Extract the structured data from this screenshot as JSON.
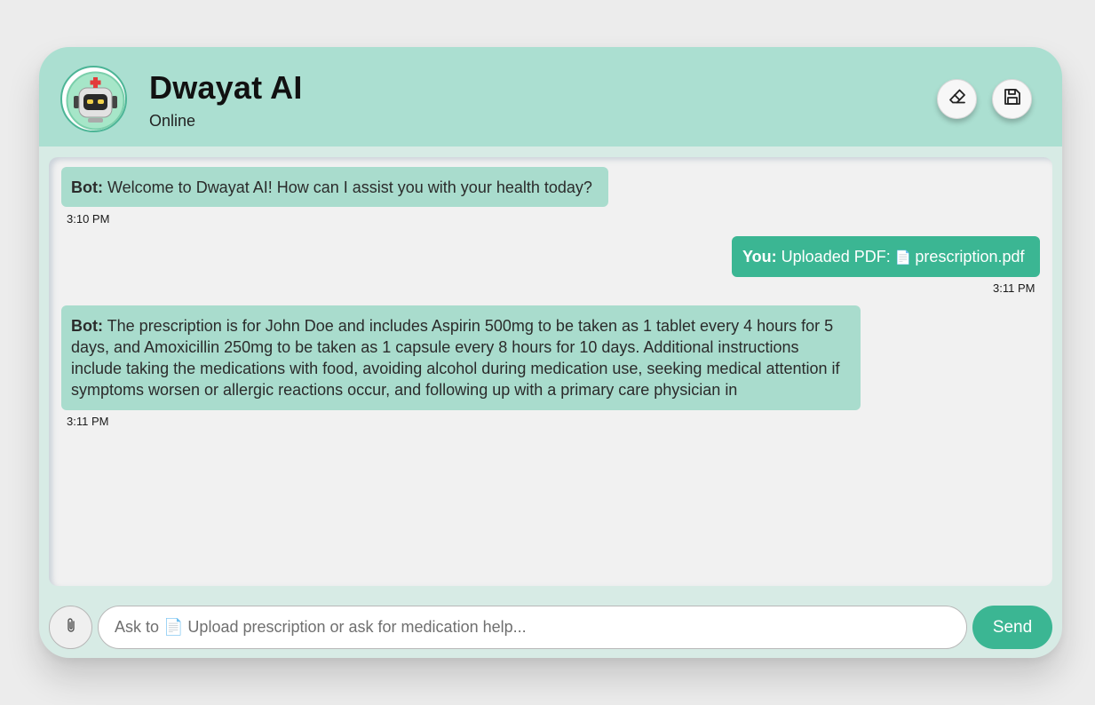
{
  "header": {
    "title": "Dwayat AI",
    "status": "Online",
    "avatar_icon": "robot-doctor-icon",
    "clear_icon": "eraser-icon",
    "save_icon": "floppy-disk-icon"
  },
  "messages": [
    {
      "sender": "Bot:",
      "text": " Welcome to Dwayat AI! How can I assist you with your health today?",
      "time": "3:10 PM"
    },
    {
      "sender": "You:",
      "text": " Uploaded PDF: ",
      "file_icon": "document-icon",
      "file_glyph": "📄",
      "file_name": "prescription.pdf",
      "time": "3:11 PM"
    },
    {
      "sender": "Bot:",
      "text": " The prescription is for John Doe and includes Aspirin 500mg to be taken as 1 tablet every 4 hours for 5 days, and Amoxicillin 250mg to be taken as 1 capsule every 8 hours for 10 days. Additional instructions include taking the medications with food, avoiding alcohol during medication use, seeking medical attention if symptoms worsen or allergic reactions occur, and following up with a primary care physician in",
      "time": "3:11 PM"
    }
  ],
  "composer": {
    "attach_icon": "paperclip-icon",
    "placeholder": "Ask to 📄 Upload prescription or ask for medication help...",
    "send_label": "Send"
  },
  "colors": {
    "header_bg": "#abdfd1",
    "accent": "#3bb693",
    "bot_bubble": "#a9dccd",
    "chat_bg": "#f1f1f1"
  }
}
